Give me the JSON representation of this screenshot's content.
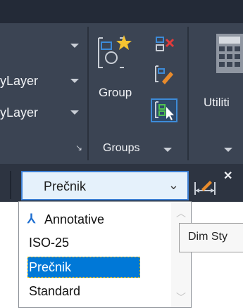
{
  "ribbon": {
    "layer_combo_1": "",
    "layer_combo_2": "yLayer",
    "layer_combo_3": "yLayer",
    "group_label": "Group",
    "groups_panel_title": "Groups",
    "utilities_label": "Utiliti"
  },
  "dimstyle": {
    "current": "Prečnik",
    "chevron": "⌄",
    "options": [
      "Annotative",
      "ISO-25",
      "Prečnik",
      "Standard"
    ],
    "selected": "Prečnik",
    "annotative_marker": "⅄"
  },
  "tooltip": {
    "text": "Dim Sty"
  },
  "icons": {
    "group": "group-icon",
    "ungroup": "ungroup-icon",
    "group_edit": "group-edit-icon",
    "group_select": "group-selection-icon",
    "utilities": "calculator-icon",
    "dimstyle_button": "dim-style-icon",
    "close": "close-icon"
  },
  "colors": {
    "ribbon_bg": "#3b4453",
    "accent": "#0078d7",
    "combo_border": "#3d7fd3"
  }
}
